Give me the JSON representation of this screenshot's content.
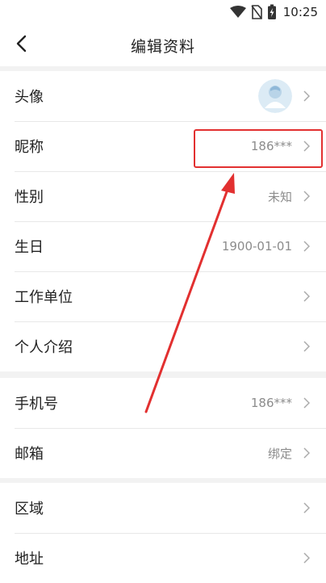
{
  "status_bar": {
    "time": "10:25",
    "icons": [
      "wifi-icon",
      "no-sim-icon",
      "battery-charging-icon"
    ]
  },
  "header": {
    "title": "编辑资料",
    "back_icon": "chevron-left-icon"
  },
  "groups": [
    {
      "rows": [
        {
          "label": "头像",
          "value": "",
          "type": "avatar"
        },
        {
          "label": "昵称",
          "value": "186***"
        },
        {
          "label": "性别",
          "value": "未知"
        },
        {
          "label": "生日",
          "value": "1900-01-01"
        },
        {
          "label": "工作单位",
          "value": ""
        },
        {
          "label": "个人介绍",
          "value": ""
        }
      ]
    },
    {
      "rows": [
        {
          "label": "手机号",
          "value": "186***"
        },
        {
          "label": "邮箱",
          "value": "绑定"
        }
      ]
    },
    {
      "rows": [
        {
          "label": "区域",
          "value": ""
        },
        {
          "label": "地址",
          "value": ""
        }
      ]
    }
  ],
  "colors": {
    "annotation": "#e23030",
    "background": "#f2f2f2",
    "row_bg": "#ffffff",
    "value_text": "#8c8c8c"
  }
}
